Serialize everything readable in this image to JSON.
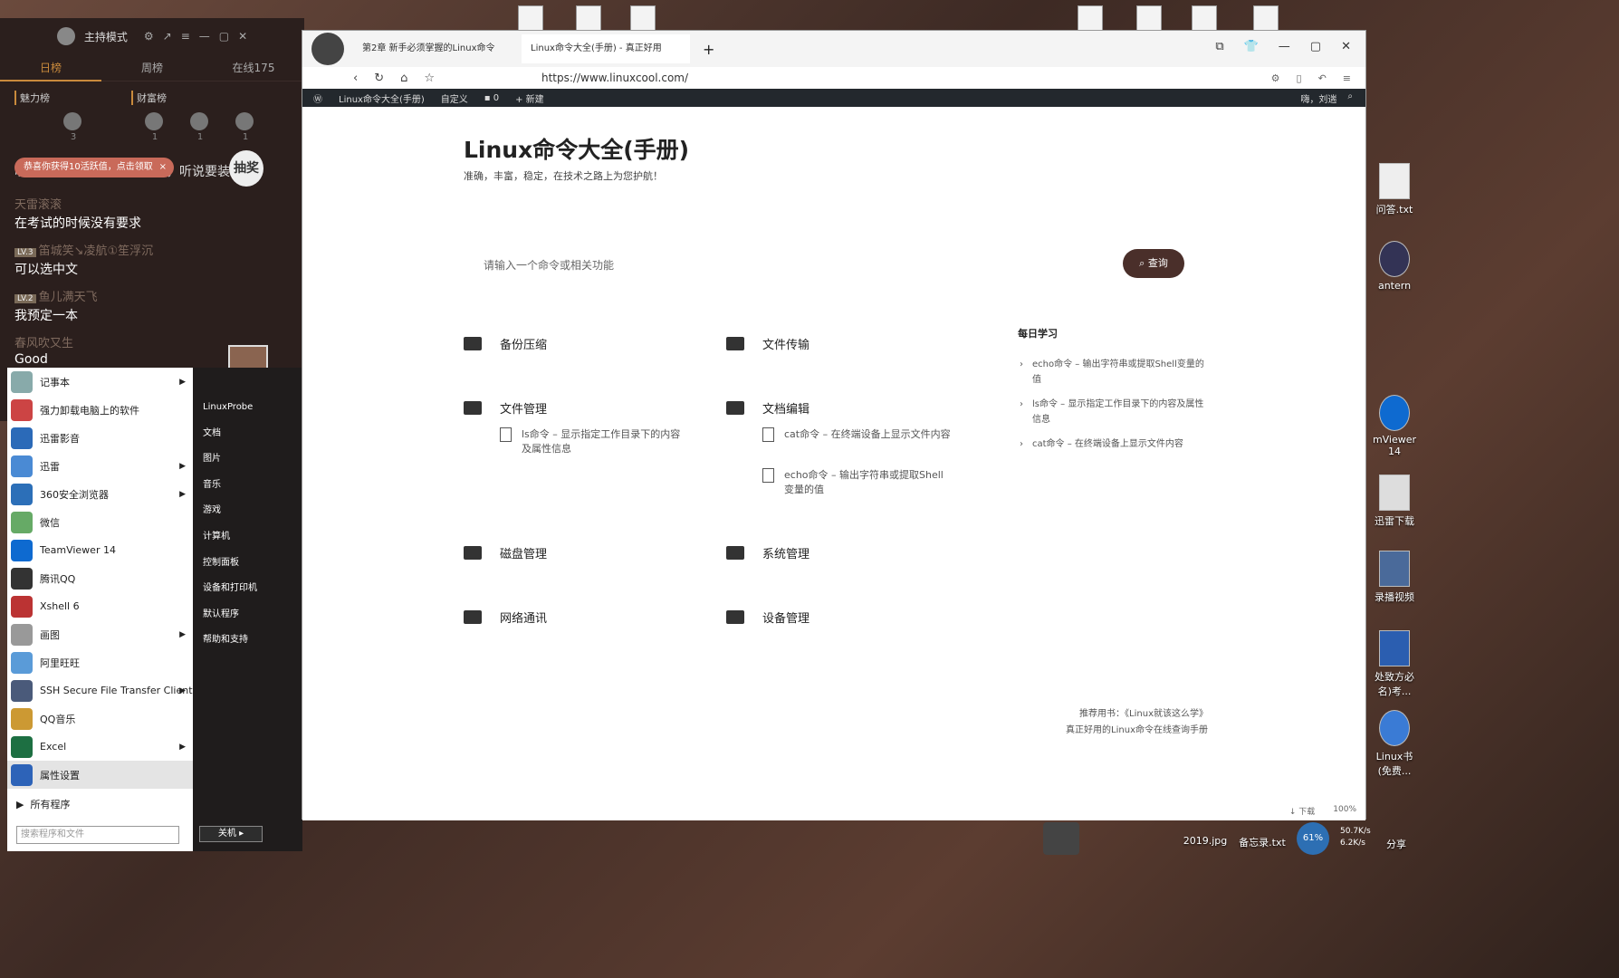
{
  "live": {
    "host": "主持模式",
    "tabs": [
      "日榜",
      "周榜",
      "在线175"
    ],
    "rank_labels": [
      "魅力榜",
      "财富榜"
    ],
    "rank_counts": [
      "3",
      "1",
      "1",
      "1"
    ],
    "banner_text": "明年夏，庄庄准备认识让看，听说要装吗",
    "notice": "恭喜你获得10活跃值，点击领取",
    "notice_close": "×",
    "lottery": "抽奖",
    "chat": [
      {
        "lv": "",
        "user": "天雷滚滚",
        "msg": "在考试的时候没有要求"
      },
      {
        "lv": "LV.3",
        "user": "笛城笑↘凌航①笙浮沉",
        "msg": "可以选中文"
      },
      {
        "lv": "LV.2",
        "user": "鱼儿满天飞",
        "msg": "我预定一本"
      },
      {
        "lv": "",
        "user": "春风吹又生",
        "msg": "Good"
      }
    ]
  },
  "start": {
    "items": [
      {
        "label": "记事本",
        "arrow": true
      },
      {
        "label": "强力卸载电脑上的软件",
        "arrow": false
      },
      {
        "label": "迅雷影音",
        "arrow": false
      },
      {
        "label": "迅雷",
        "arrow": true
      },
      {
        "label": "360安全浏览器",
        "arrow": true
      },
      {
        "label": "微信",
        "arrow": false
      },
      {
        "label": "TeamViewer 14",
        "arrow": false
      },
      {
        "label": "腾讯QQ",
        "arrow": false
      },
      {
        "label": "Xshell 6",
        "arrow": false
      },
      {
        "label": "画图",
        "arrow": true
      },
      {
        "label": "阿里旺旺",
        "arrow": false
      },
      {
        "label": "SSH Secure File Transfer Client",
        "arrow": true
      },
      {
        "label": "QQ音乐",
        "arrow": false
      },
      {
        "label": "Excel",
        "arrow": true
      },
      {
        "label": "属性设置",
        "arrow": false
      }
    ],
    "all_programs": "所有程序",
    "search_placeholder": "搜索程序和文件",
    "right": [
      "LinuxProbe",
      "文档",
      "图片",
      "音乐",
      "游戏",
      "计算机",
      "控制面板",
      "设备和打印机",
      "默认程序",
      "帮助和支持"
    ],
    "shutdown": "关机"
  },
  "browser": {
    "tabs": [
      "第2章 新手必须掌握的Linux命令",
      "Linux命令大全(手册) - 真正好用"
    ],
    "url": "https://www.linuxcool.com/",
    "zoom": "100%",
    "wp": [
      "Linux命令大全(手册)",
      "自定义",
      "0",
      "新建"
    ],
    "wp_user": "嗨，刘遄",
    "status_download": "下载"
  },
  "page": {
    "title": "Linux命令大全(手册)",
    "subtitle": "准确，丰富，稳定，在技术之路上为您护航！",
    "search_placeholder": "请输入一个命令或相关功能",
    "search_btn": "查询",
    "categories": [
      "备份压缩",
      "文件传输",
      "文件管理",
      "文档编辑",
      "磁盘管理",
      "系统管理",
      "网络通讯",
      "设备管理"
    ],
    "articles": [
      "ls命令 – 显示指定工作目录下的内容及属性信息",
      "cat命令 – 在终端设备上显示文件内容",
      "echo命令 – 输出字符串或提取Shell变量的值"
    ],
    "daily_title": "每日学习",
    "daily": [
      "echo命令 – 输出字符串或提取Shell变量的值",
      "ls命令 – 显示指定工作目录下的内容及属性信息",
      "cat命令 – 在终端设备上显示文件内容"
    ],
    "footer": [
      "推荐用书：《Linux就该这么学》",
      "真正好用的Linux命令在线查询手册"
    ]
  },
  "desktop": {
    "icons": [
      "问答.txt",
      "antern",
      "mViewer 14",
      "迅雷下载",
      "录播视频",
      "处致方必 名)考...",
      "Linux书 (免费...",
      "2019.jpg",
      "备忘录.txt",
      "分享"
    ],
    "net_up": "50.7K/s",
    "net_down": "6.2K/s",
    "cpu": "61%"
  }
}
